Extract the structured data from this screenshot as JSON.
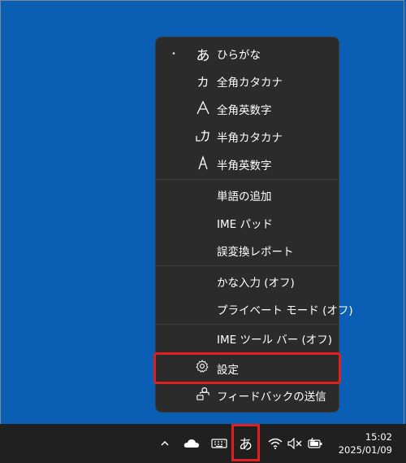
{
  "menu": {
    "items": [
      {
        "label": "ひらがな",
        "icon": "あ",
        "icon_name": "hiragana-icon",
        "selected_bullet": "•"
      },
      {
        "label": "全角カタカナ",
        "icon": "カ",
        "icon_name": "fullwidth-katakana-icon"
      },
      {
        "label": "全角英数字",
        "icon": "A",
        "icon_name": "fullwidth-alphanumeric-icon"
      },
      {
        "label": "半角カタカナ",
        "icon": "_カ",
        "icon_name": "halfwidth-katakana-icon"
      },
      {
        "label": "半角英数字",
        "icon": "A",
        "icon_name": "halfwidth-alphanumeric-icon"
      },
      {
        "label": "単語の追加"
      },
      {
        "label": "IME パッド"
      },
      {
        "label": "誤変換レポート"
      },
      {
        "label": "かな入力 (オフ)"
      },
      {
        "label": "プライベート モード (オフ)"
      },
      {
        "label": "IME ツール バー (オフ)"
      },
      {
        "label": "設定",
        "icon_name": "gear-icon"
      },
      {
        "label": "フィードバックの送信",
        "icon_name": "feedback-icon"
      }
    ]
  },
  "taskbar": {
    "ime_indicator": "あ",
    "time": "15:02",
    "date": "2025/01/09"
  },
  "colors": {
    "desktop": "#0a5fb4",
    "menu_bg": "#2b2b2b",
    "highlight_border": "#e01f1f",
    "taskbar_bg": "#202020"
  }
}
